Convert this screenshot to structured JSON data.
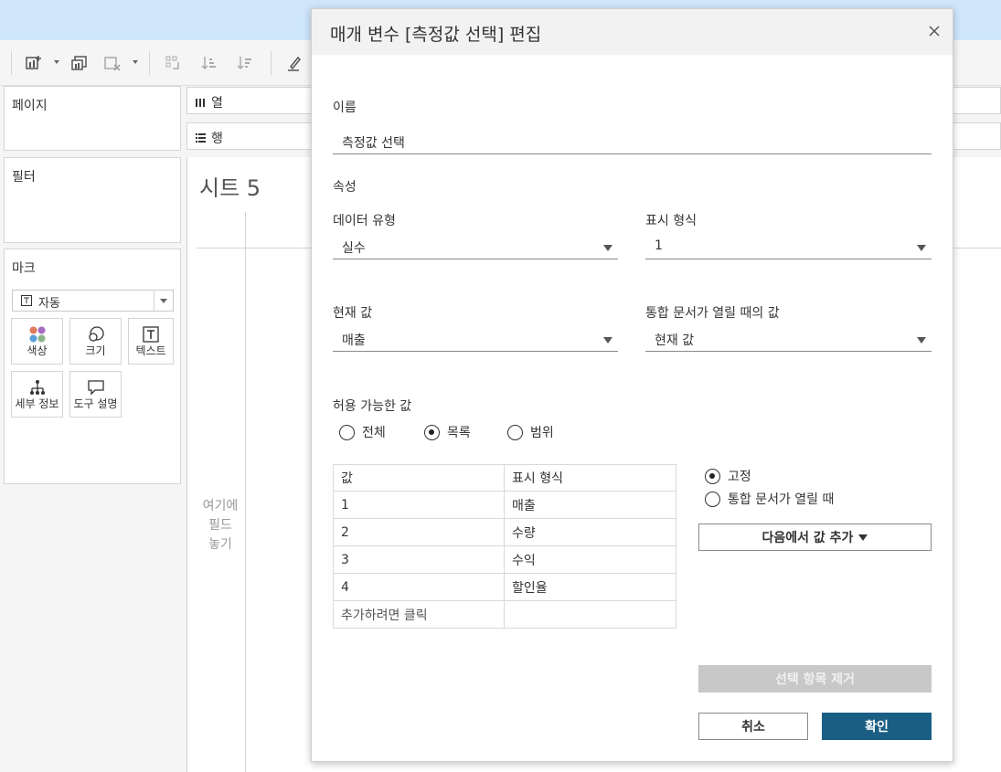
{
  "workspace": {
    "pages_label": "페이지",
    "filters_label": "필터",
    "marks_label": "마크",
    "columns_label": "열",
    "rows_label": "행",
    "mark_type": "자동",
    "mark_buttons": [
      {
        "label": "색상",
        "icon": "color-dots-icon"
      },
      {
        "label": "크기",
        "icon": "size-icon"
      },
      {
        "label": "텍스트",
        "icon": "text-icon"
      },
      {
        "label": "세부 정보",
        "icon": "detail-icon"
      },
      {
        "label": "도구 설명",
        "icon": "tooltip-icon"
      }
    ],
    "sheet_title": "시트 5",
    "drop_hint_lines": [
      "여기에",
      "필드",
      "놓기"
    ]
  },
  "dialog": {
    "title": "매개 변수 [측정값 선택] 편집",
    "name_label": "이름",
    "name_value": "측정값 선택",
    "properties_label": "속성",
    "data_type_label": "데이터 유형",
    "data_type_value": "실수",
    "display_format_label": "표시 형식",
    "display_format_value": "1",
    "current_value_label": "현재 값",
    "current_value_value": "매출",
    "open_value_label": "통합 문서가 열릴 때의 값",
    "open_value_value": "현재 값",
    "allowable_label": "허용 가능한 값",
    "allowable_options": [
      {
        "label": "전체",
        "selected": false
      },
      {
        "label": "목록",
        "selected": true
      },
      {
        "label": "범위",
        "selected": false
      }
    ],
    "table": {
      "headers": [
        "값",
        "표시 형식"
      ],
      "rows": [
        [
          "1",
          "매출"
        ],
        [
          "2",
          "수량"
        ],
        [
          "3",
          "수익"
        ],
        [
          "4",
          "할인율"
        ]
      ],
      "add_row_label": "추가하려면 클릭"
    },
    "fixed_options": [
      {
        "label": "고정",
        "selected": true
      },
      {
        "label": "통합 문서가 열릴 때",
        "selected": false
      }
    ],
    "add_values_button": "다음에서 값 추가",
    "remove_selected_button": "선택 항목 제거",
    "cancel_button": "취소",
    "ok_button": "확인",
    "colors": {
      "primary": "#1a5e84",
      "topbar": "#cfe6fb"
    }
  }
}
